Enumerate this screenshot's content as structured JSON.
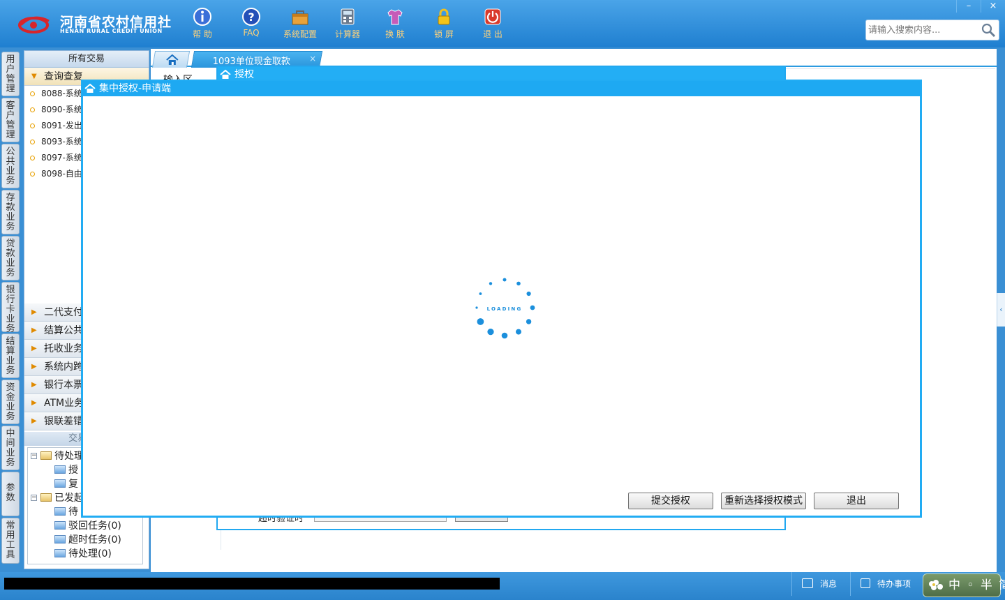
{
  "header": {
    "logo_cn": "河南省农村信用社",
    "logo_en": "HENAN RURAL CREDIT UNION",
    "tools": [
      {
        "label": "帮 助",
        "icon": "info-icon"
      },
      {
        "label": "FAQ",
        "icon": "question-icon"
      },
      {
        "label": "系统配置",
        "icon": "toolbox-icon"
      },
      {
        "label": "计算器",
        "icon": "calculator-icon"
      },
      {
        "label": "换 肤",
        "icon": "shirt-icon"
      },
      {
        "label": "锁 屏",
        "icon": "lock-icon"
      },
      {
        "label": "退 出",
        "icon": "power-icon"
      }
    ],
    "window_controls": {
      "minimize": "–",
      "close": "×"
    },
    "search_placeholder": "请输入搜索内容..."
  },
  "vertical_tabs": [
    "用户管理",
    "客户管理",
    "公共业务",
    "存款业务",
    "贷款业务",
    "银行卡业务",
    "结算业务",
    "资金业务",
    "中间业务",
    "参数",
    "常用工具"
  ],
  "left_panel": {
    "title": "所有交易",
    "open_group": "查询查复",
    "items": [
      "8088-系统",
      "8090-系统",
      "8091-发出",
      "8093-系统",
      "8097-系统",
      "8098-自由"
    ],
    "groups": [
      "二代支付",
      "结算公共",
      "托收业务",
      "系统内跨",
      "银行本票",
      "ATM业务",
      "银联差错"
    ],
    "tx_info": {
      "title": "交易信息",
      "nodes": [
        "待处理",
        "授",
        "复",
        "已发起",
        "待",
        "驳回任务(0)",
        "超时任务(0)",
        "待处理(0)"
      ]
    }
  },
  "tabs": {
    "active": "1093单位现金取款",
    "close": "×",
    "input_area": "输入区"
  },
  "auth_dialog": {
    "title": "授权",
    "field_label": "超时验证时"
  },
  "main_dialog": {
    "title": "集中授权-申请端",
    "loading_text": "LOADING",
    "buttons": {
      "submit": "提交授权",
      "reselect": "重新选择授权模式",
      "exit": "退出"
    }
  },
  "statusbar": {
    "messages": "消息",
    "todo": "待办事项",
    "ime": "中 ◦ 半 简"
  },
  "colors": {
    "header_blue": "#1f7fd0",
    "dialog_title": "#1ea9f2",
    "tool_label": "#ffd27a",
    "loader_dot": "#1b8fdc"
  }
}
